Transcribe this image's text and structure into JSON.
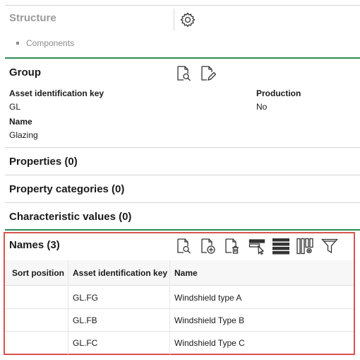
{
  "structure": {
    "title": "Structure",
    "items": [
      "Components"
    ]
  },
  "group": {
    "title": "Group",
    "fields": {
      "asset_key_label": "Asset identification key",
      "asset_key_value": "GL",
      "production_label": "Production",
      "production_value": "No",
      "name_label": "Name",
      "name_value": "Glazing"
    }
  },
  "sections": {
    "properties": "Properties (0)",
    "property_categories": "Property categories (0)",
    "characteristic_values": "Characteristic values (0)"
  },
  "names": {
    "title": "Names (3)",
    "toolbar_icons": [
      "view-details-icon",
      "add-document-icon",
      "delete-document-icon",
      "select-columns-icon",
      "list-view-icon",
      "column-settings-icon",
      "filter-icon"
    ],
    "columns": [
      "Sort position",
      "Asset identification key",
      "Name"
    ],
    "rows": [
      {
        "sort_position": "",
        "asset_key": "GL.FG",
        "name": "Windshield type A"
      },
      {
        "sort_position": "",
        "asset_key": "GL.FB",
        "name": "Windshield Type B"
      },
      {
        "sort_position": "",
        "asset_key": "GL.FC",
        "name": "Windshield Type C"
      }
    ]
  },
  "colors": {
    "accent_line": "#2e8b57",
    "selection_border": "#d9534f"
  }
}
